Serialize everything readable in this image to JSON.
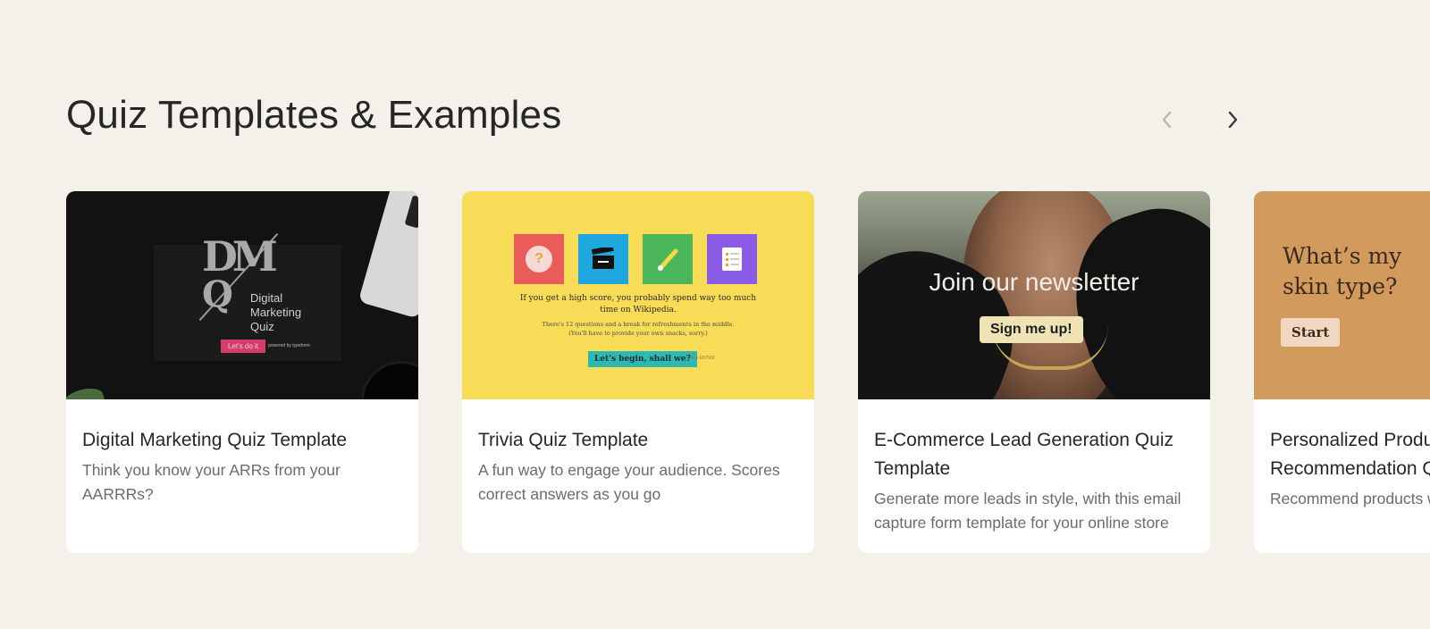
{
  "section": {
    "title": "Quiz Templates & Examples"
  },
  "carousel": {
    "prev_icon": "chevron-left-icon",
    "next_icon": "chevron-right-icon",
    "cards": [
      {
        "title": "Digital Marketing Quiz Template",
        "description": "Think you know your ARRs from your AARRRs?",
        "thumb": {
          "logo_letters": "DM",
          "logo_q": "Q",
          "logo_text": "Digital Marketing Quiz",
          "button": "Let's do it",
          "brand": "powered by typeform"
        }
      },
      {
        "title": "Trivia Quiz Template",
        "description": "A fun way to engage your audience. Scores correct answers as you go",
        "thumb": {
          "line1": "If you get a high score, you probably spend way too much time on Wikipedia.",
          "line2": "There's 12 questions and a break for refreshments in the middle. (You'll have to provide your own snacks, sorry.)",
          "button": "Let's begin, shall we?",
          "brand": "press ENTER",
          "question_mark": "?"
        }
      },
      {
        "title": "E-Commerce Lead Generation Quiz Template",
        "description": "Generate more leads in style, with this email capture form template for your online store",
        "thumb": {
          "headline": "Join our newsletter",
          "button": "Sign me up!"
        }
      },
      {
        "title": "Personalized Product Recommendation Quiz",
        "description": "Recommend products with an engaging quiz",
        "thumb": {
          "question": "What’s my skin type?",
          "button": "Start"
        }
      }
    ]
  }
}
